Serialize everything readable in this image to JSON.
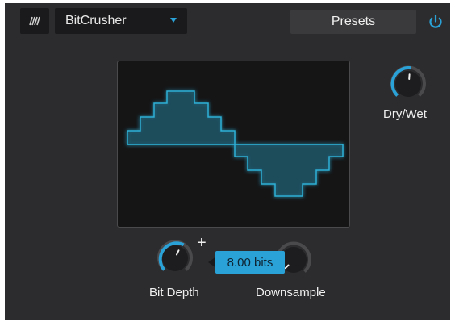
{
  "plugin": {
    "selected_effect": "BitCrusher",
    "presets_label": "Presets"
  },
  "knobs": {
    "dry_wet": {
      "label": "Dry/Wet",
      "value_fraction": 0.55
    },
    "bit_depth": {
      "label": "Bit Depth",
      "value_fraction": 0.72
    },
    "downsample": {
      "label": "Downsample",
      "value_fraction": 0.0
    }
  },
  "tooltip": {
    "text": "8.00 bits"
  },
  "colors": {
    "accent": "#2aa2d8",
    "panel": "#2c2c2e",
    "dark": "#1a1a1c"
  },
  "icons": {
    "logo": "waveform-logo-icon",
    "dropdown": "caret-down-icon",
    "power": "power-icon",
    "add": "plus-icon"
  }
}
